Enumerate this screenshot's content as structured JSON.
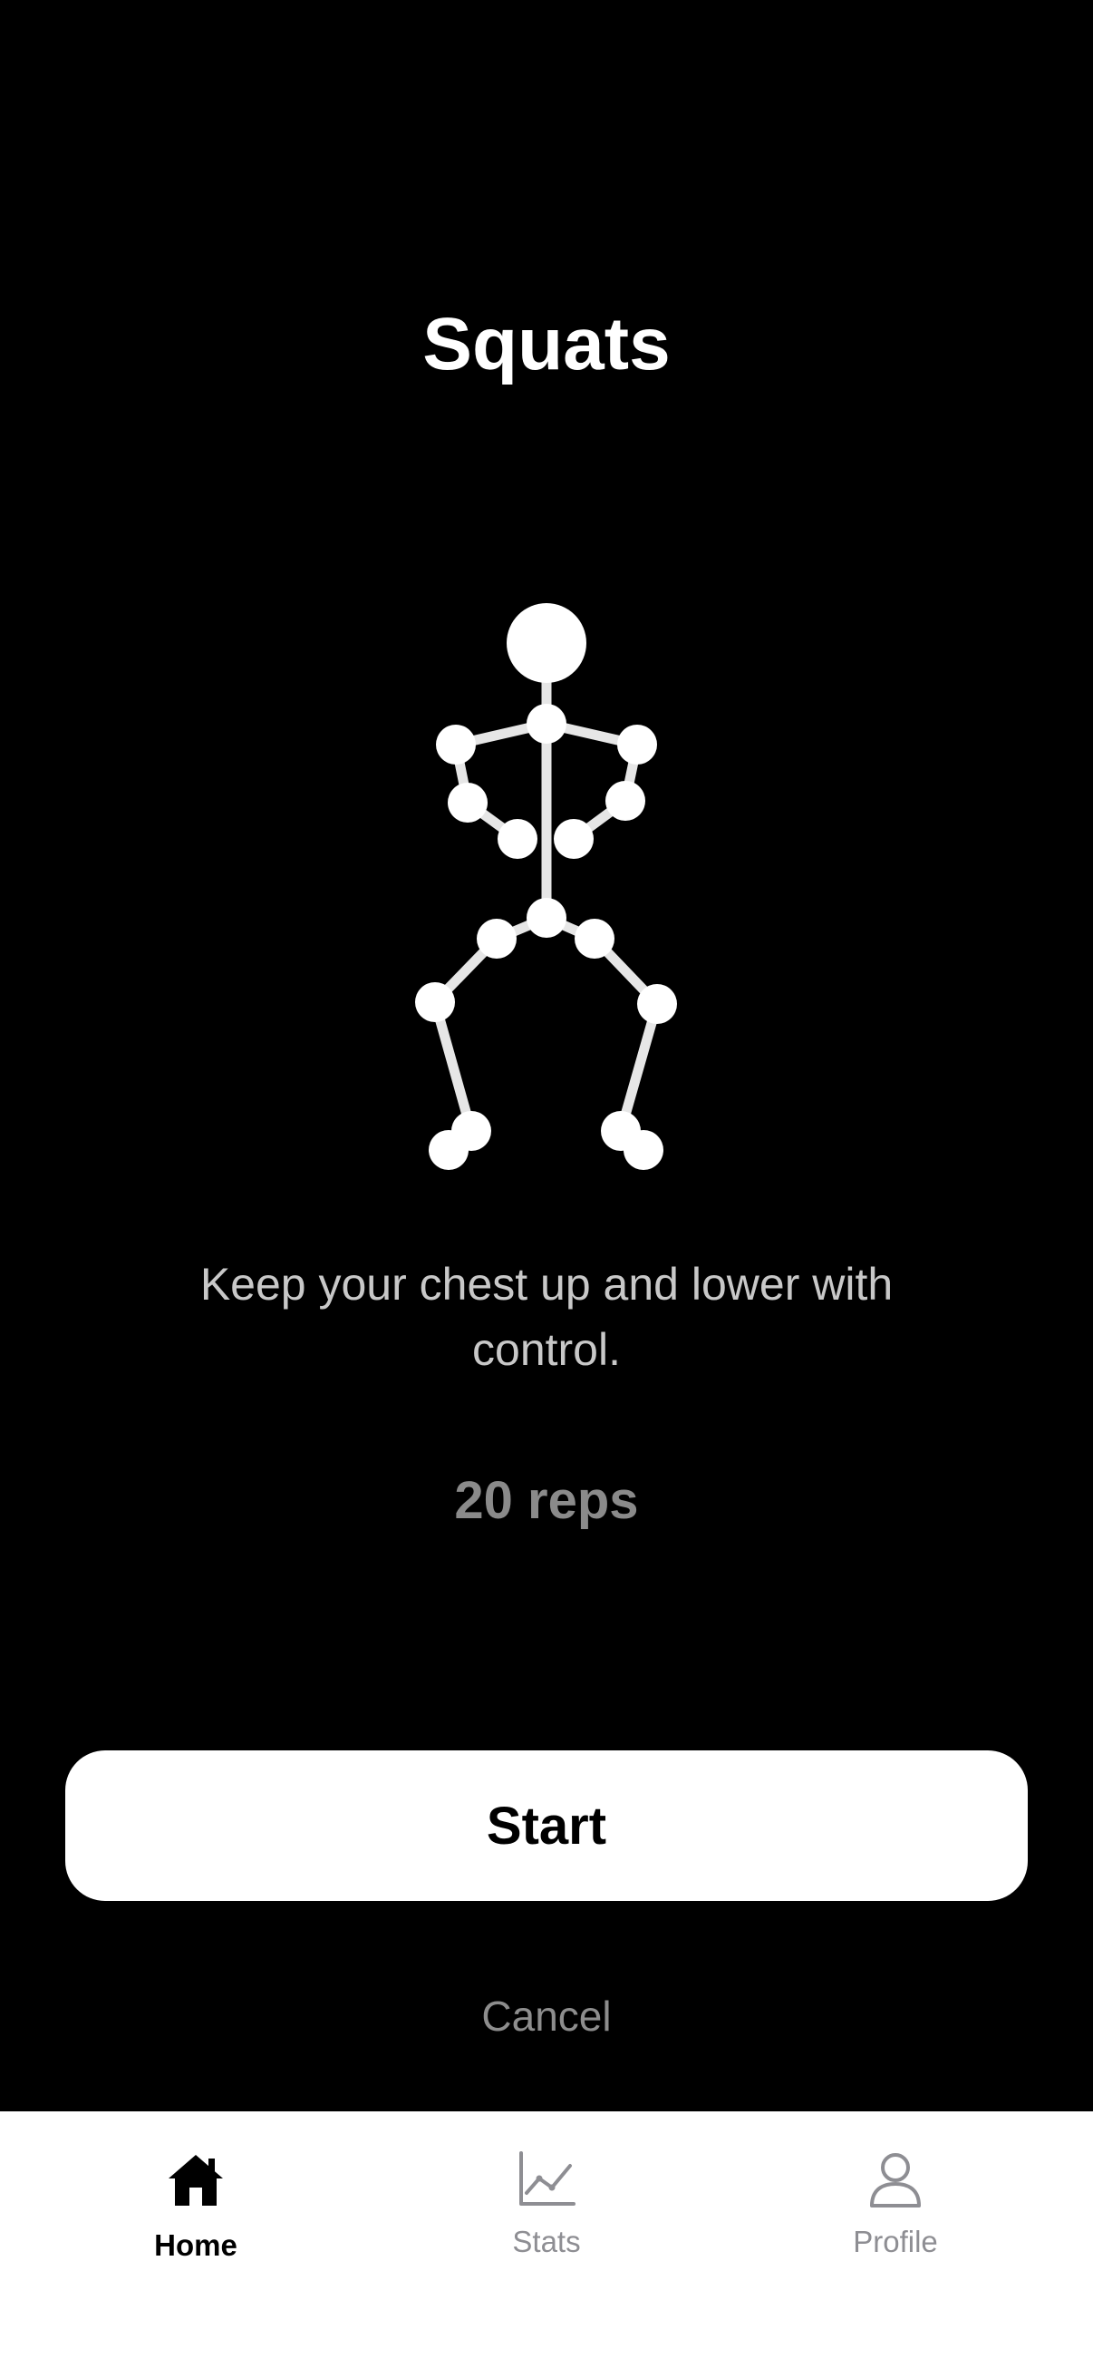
{
  "exercise": {
    "title": "Squats",
    "instruction": "Keep your chest up and lower with control.",
    "reps": "20 reps"
  },
  "actions": {
    "start_label": "Start",
    "cancel_label": "Cancel"
  },
  "figure": {
    "icon": "stick-figure-squat"
  },
  "tabbar": {
    "tabs": [
      {
        "label": "Home",
        "icon": "home-icon",
        "active": true
      },
      {
        "label": "Stats",
        "icon": "chart-icon",
        "active": false
      },
      {
        "label": "Profile",
        "icon": "person-icon",
        "active": false
      }
    ]
  },
  "colors": {
    "background": "#000000",
    "primary_text": "#ffffff",
    "secondary_text": "#c8c8c8",
    "muted_text": "#8a8a8a",
    "tab_inactive": "#8e8e93"
  }
}
